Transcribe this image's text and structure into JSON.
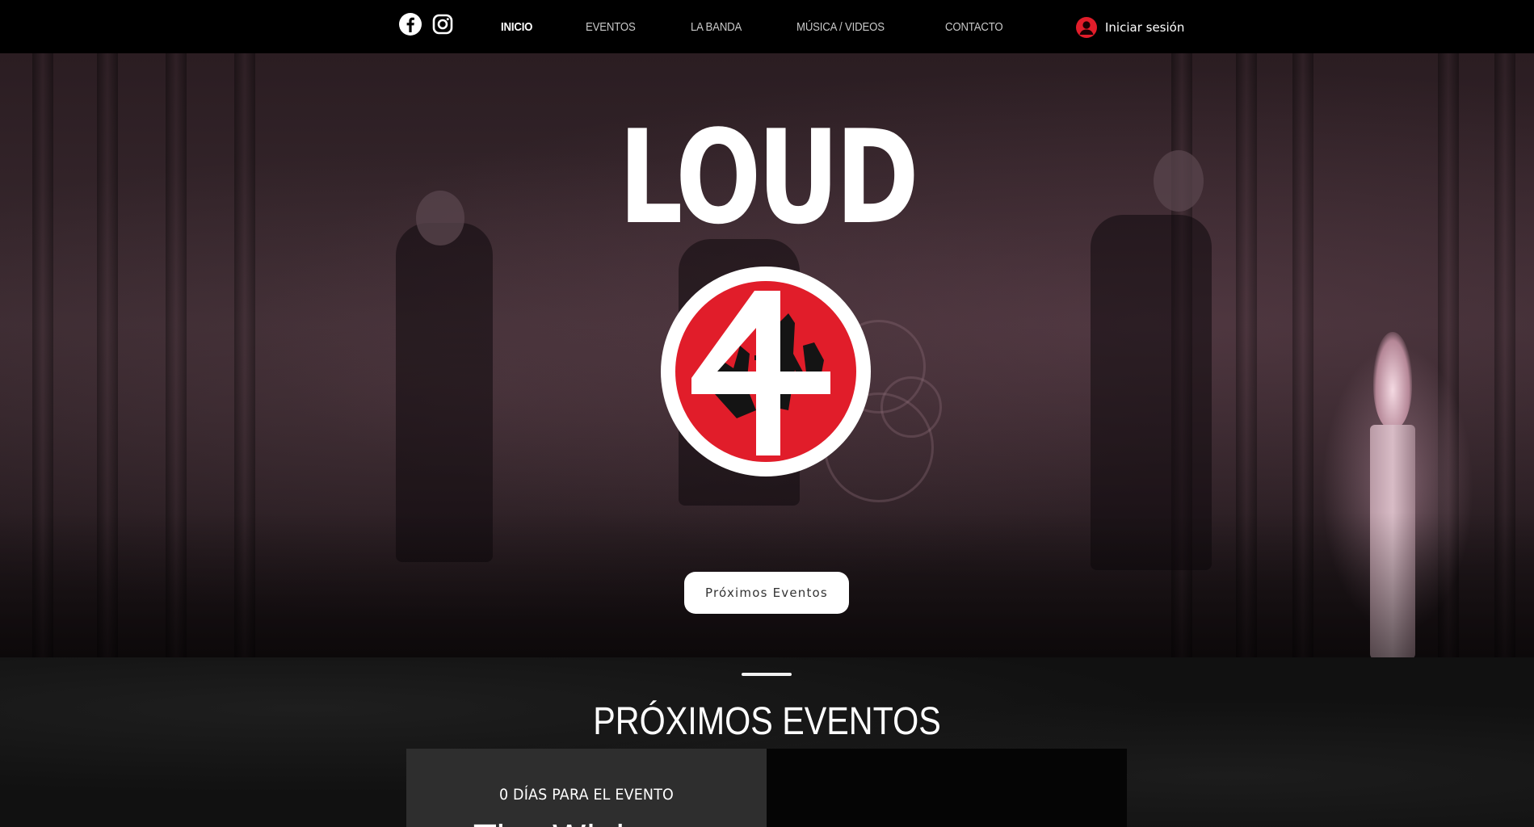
{
  "header": {
    "social": [
      {
        "icon": "facebook-icon"
      },
      {
        "icon": "instagram-icon"
      }
    ],
    "nav": [
      {
        "label": "INICIO",
        "active": true
      },
      {
        "label": "EVENTOS"
      },
      {
        "label": "LA BANDA"
      },
      {
        "label": "MÚSICA / VIDEOS"
      },
      {
        "label": "CONTACTO"
      }
    ],
    "login_label": "Iniciar sesión",
    "login_icon": "user-avatar-icon"
  },
  "hero": {
    "logo_text": "LOUD",
    "cta_label": "Próximos Eventos"
  },
  "events": {
    "title": "PRÓXIMOS EVENTOS",
    "countdown_days": "0",
    "countdown_label": "DÍAS PARA EL EVENTO",
    "event_name": "The Wick"
  },
  "colors": {
    "accent_red": "#e11d2a",
    "header_bg": "#000000",
    "card_bg": "#2e2e2e"
  }
}
